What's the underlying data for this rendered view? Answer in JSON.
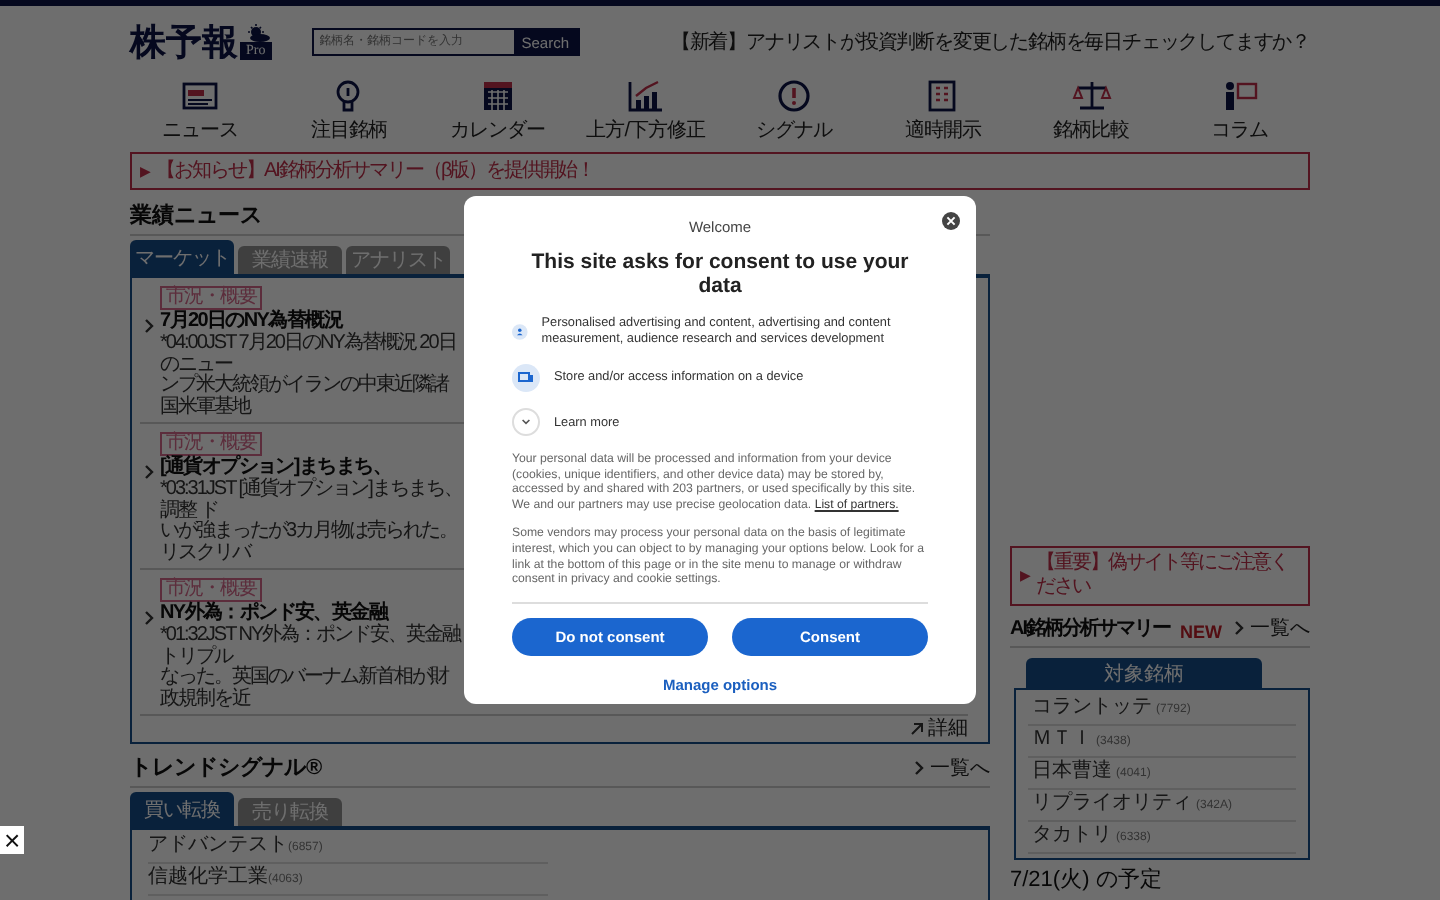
{
  "header": {
    "logo": "株予報",
    "logo_badge": "Pro",
    "search": {
      "placeholder": "銘柄名・銘柄コードを入力",
      "button": "Search"
    },
    "promo": "【新着】アナリストが投資判断を変更した銘柄を毎日チェックしてますか？"
  },
  "nav": [
    {
      "label": "ニュース"
    },
    {
      "label": "注目銘柄"
    },
    {
      "label": "カレンダー"
    },
    {
      "label": "上方/下方修正"
    },
    {
      "label": "シグナル"
    },
    {
      "label": "適時開示"
    },
    {
      "label": "銘柄比較"
    },
    {
      "label": "コラム"
    }
  ],
  "notice": {
    "marker": "▶",
    "text": "【お知らせ】AI銘柄分析サマリー（β版）を提供開始！"
  },
  "news": {
    "title": "業績ニュース",
    "tabs": [
      {
        "label": "マーケット",
        "selected": true
      },
      {
        "label": "業績速報",
        "selected": false
      },
      {
        "label": "アナリスト",
        "selected": false
      }
    ],
    "items": [
      {
        "tag": "市況・概要",
        "title": "7月20日のNY為替概況",
        "lines": [
          "*04:00JST 7月20日のNY為替概況 20日のニュー",
          "ンプ米大統領がイランの中東近隣諸国米軍基地"
        ]
      },
      {
        "tag": "市況・概要",
        "title": "[通貨オプション]まちまち、",
        "lines": [
          "*03:31JST [通貨オプション]まちまち、調整 ド",
          "いが強まったが3カ月物は売られた。リスクリバ"
        ]
      },
      {
        "tag": "市況・概要",
        "title": "NY外為：ポンド安、英金融",
        "lines": [
          "*01:32JST NY外為：ポンド安、英金融トリプル",
          "なった。英国のバーナム新首相が財政規制を近"
        ]
      }
    ],
    "more": "詳細"
  },
  "trend": {
    "title": "トレンドシグナル®",
    "more": "一覧へ",
    "tabs": [
      {
        "label": "買い転換",
        "selected": true
      },
      {
        "label": "売り転換",
        "selected": false
      }
    ],
    "items": [
      {
        "name": "アドバンテスト",
        "code": "(6857)"
      },
      {
        "name": "信越化学工業",
        "code": "(4063)"
      }
    ]
  },
  "side": {
    "notice": {
      "marker": "▶",
      "text": "【重要】偽サイト等にご注意ください"
    },
    "summary": {
      "title": "AI銘柄分析サマリー",
      "badge": "NEW",
      "more": "一覧へ",
      "tab": "対象銘柄",
      "items": [
        {
          "name": "コラントッテ",
          "code": "(7792)"
        },
        {
          "name": "ＭＴＩ",
          "code": "(3438)"
        },
        {
          "name": "日本曹達",
          "code": "(4041)"
        },
        {
          "name": "リプライオリティ",
          "code": "(342A)"
        },
        {
          "name": "タカトリ",
          "code": "(6338)"
        }
      ]
    },
    "schedule_title": "7/21(火) の予定"
  },
  "ad_close": "×",
  "consent": {
    "heading": "Welcome",
    "title": "This site asks for consent to use your data",
    "purposes": [
      {
        "text": "Personalised advertising and content, advertising and content measurement, audience research and services development"
      },
      {
        "text": "Store and/or access information on a device"
      }
    ],
    "learn_more": "Learn more",
    "paragraphs": [
      {
        "text": "Your personal data will be processed and information from your device (cookies, unique identifiers, and other device data) may be stored by, accessed by and shared with 203 partners, or used specifically by this site. We and our partners may use precise geolocation data.",
        "link": "List of partners."
      },
      {
        "text": "Some vendors may process your personal data on the basis of legitimate interest, which you can object to by managing your options below. Look for a link at the bottom of this page or in the site menu to manage or withdraw consent in privacy and cookie settings."
      }
    ],
    "buttons": [
      "Do not consent",
      "Consent"
    ],
    "manage": "Manage options"
  }
}
